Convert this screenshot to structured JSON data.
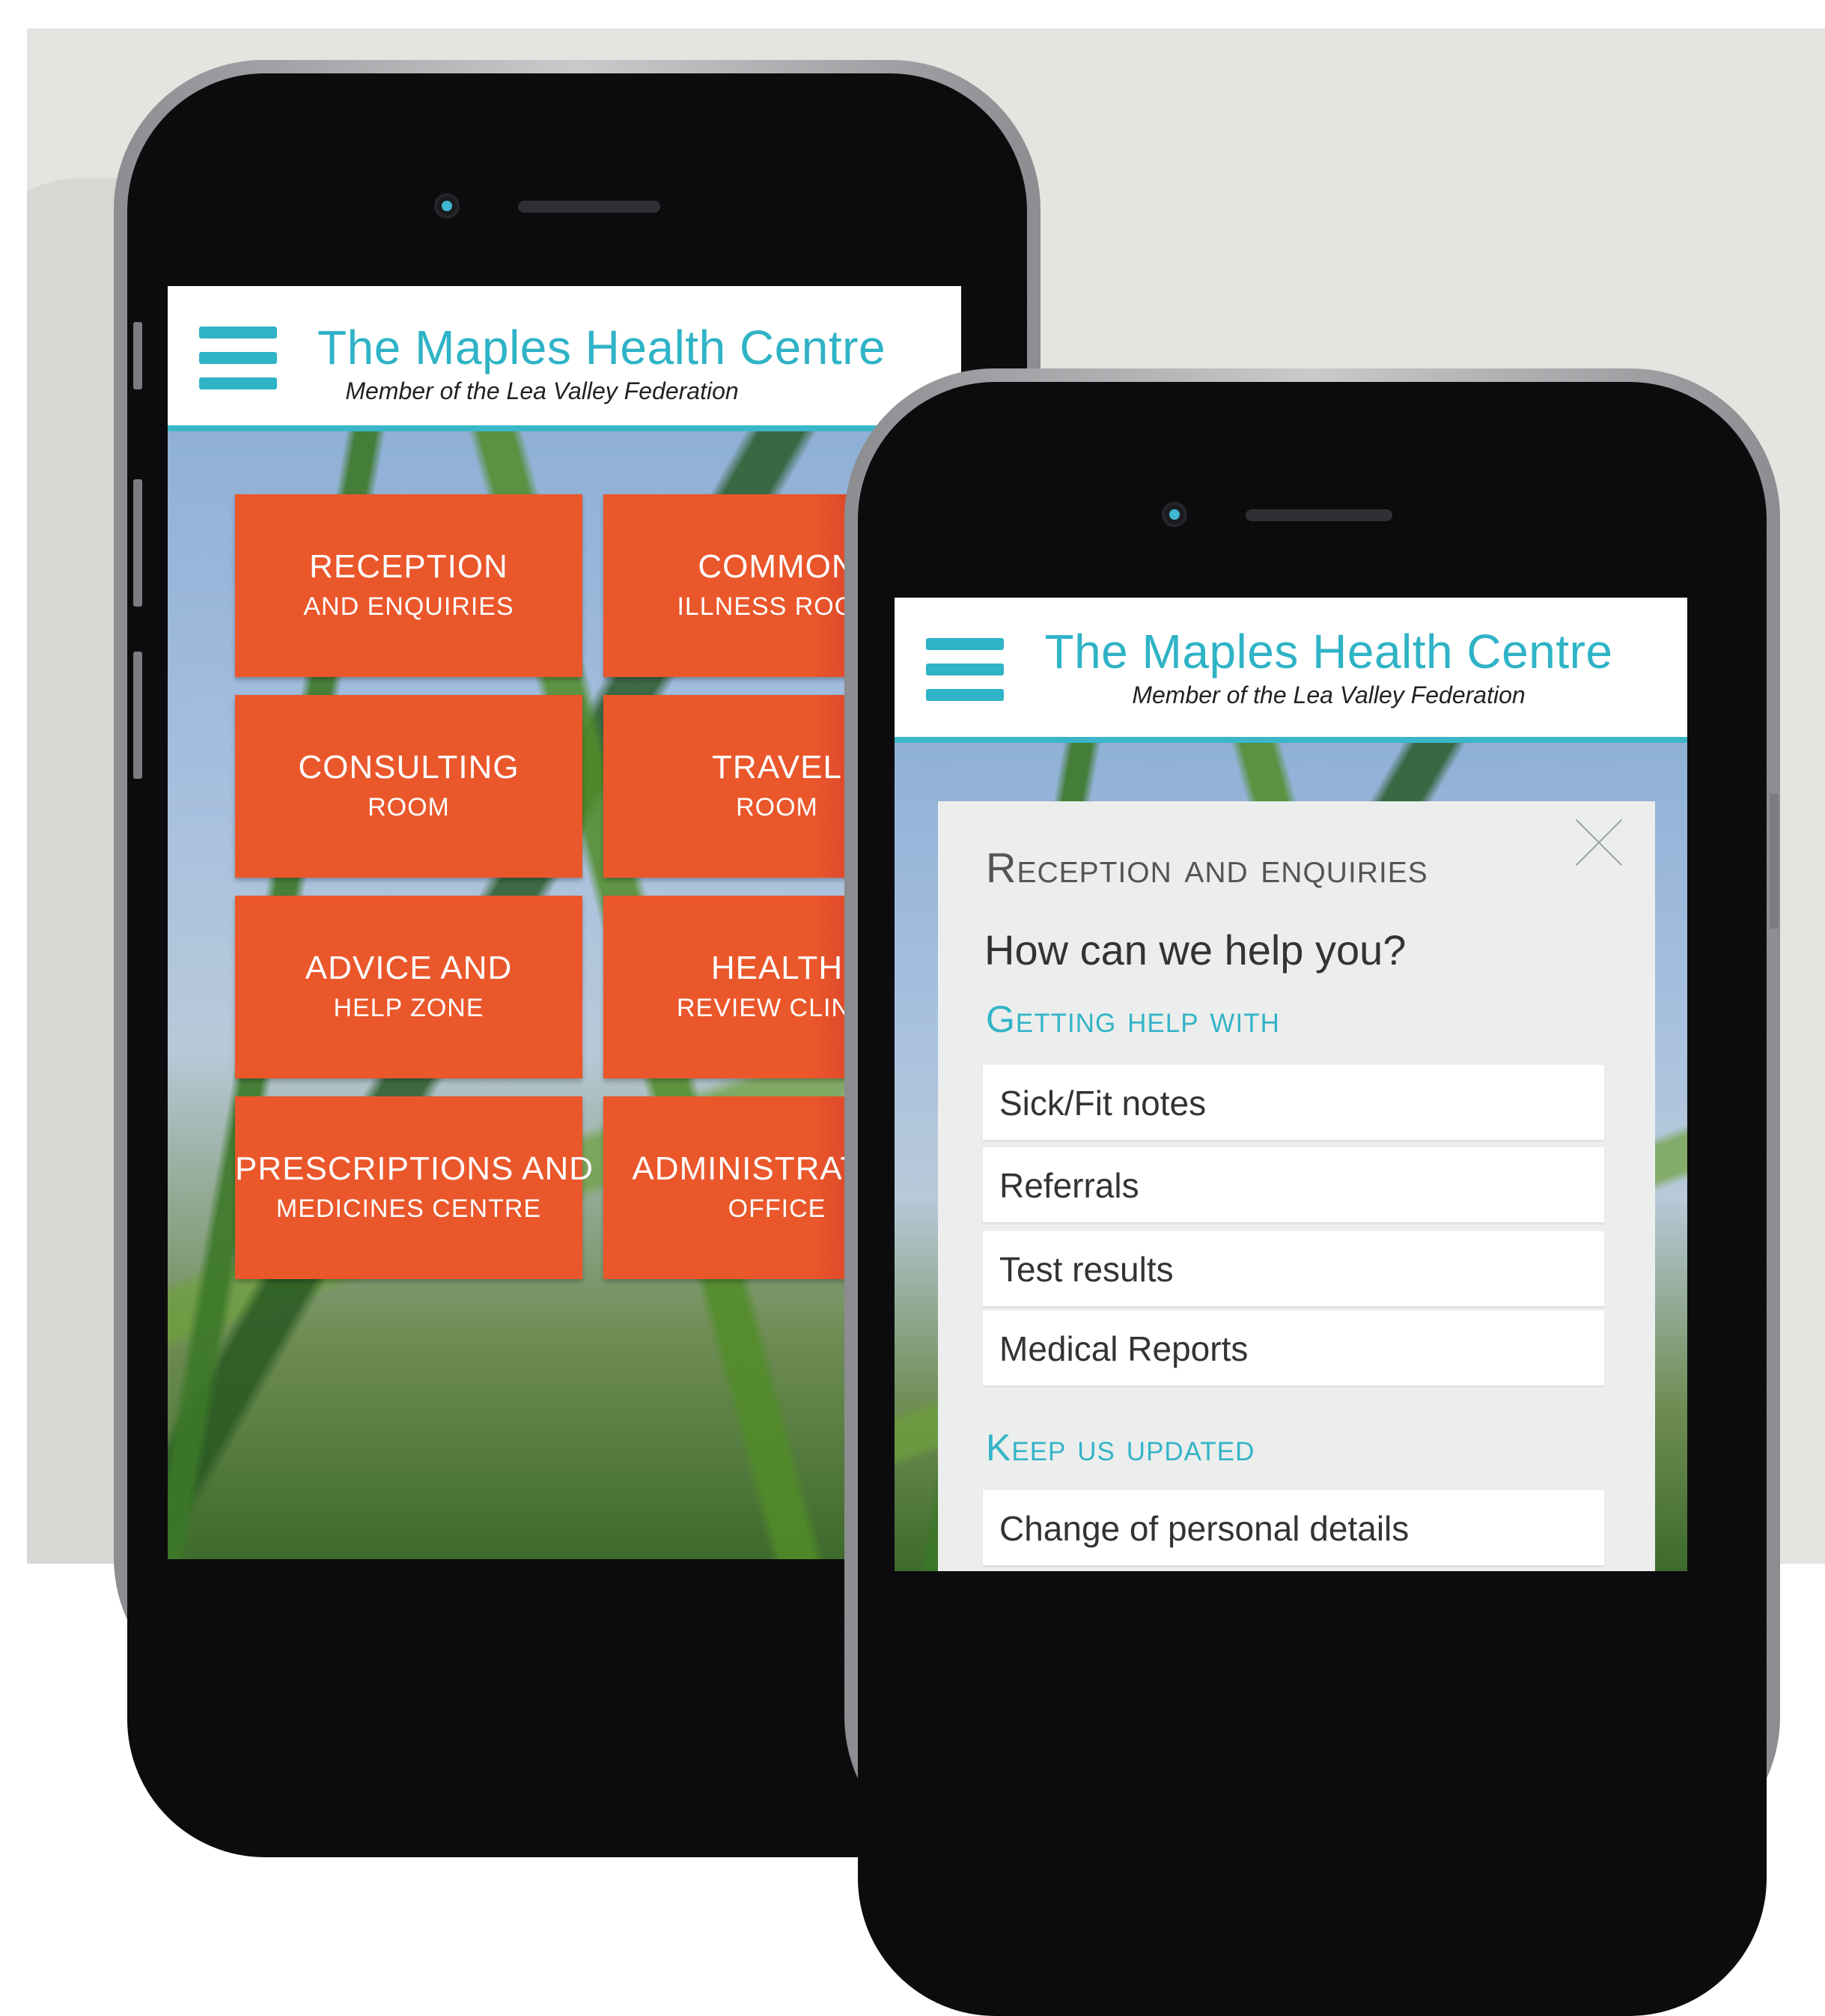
{
  "app": {
    "title": "The Maples Health Centre",
    "subtitle": "Member of the Lea Valley Federation"
  },
  "tiles": [
    {
      "line1": "RECEPTION",
      "line2": "AND ENQUIRIES"
    },
    {
      "line1": "COMMON",
      "line2": "ILLNESS ROOM"
    },
    {
      "line1": "CONSULTING",
      "line2": "ROOM"
    },
    {
      "line1": "TRAVEL",
      "line2": "ROOM"
    },
    {
      "line1": "ADVICE AND",
      "line2": "HELP ZONE"
    },
    {
      "line1": "HEALTH",
      "line2": "REVIEW CLINIC"
    },
    {
      "line1": "PRESCRIPTIONS AND",
      "line2": "MEDICINES CENTRE"
    },
    {
      "line1": "ADMINISTRATION",
      "line2": "OFFICE"
    }
  ],
  "panel": {
    "title": "Reception and enquiries",
    "question": "How can we help you?",
    "sections": [
      {
        "heading": "Getting help with",
        "items": [
          "Sick/Fit notes",
          "Referrals",
          "Test results",
          "Medical Reports"
        ]
      },
      {
        "heading": "Keep us updated",
        "items": [
          "Change of personal details"
        ]
      }
    ]
  },
  "colors": {
    "accent": "#2fb3c6",
    "tile": "#ea572b",
    "background": "#e3e5e0"
  },
  "icons": {
    "menu": "hamburger-menu-icon",
    "close": "close-icon"
  }
}
